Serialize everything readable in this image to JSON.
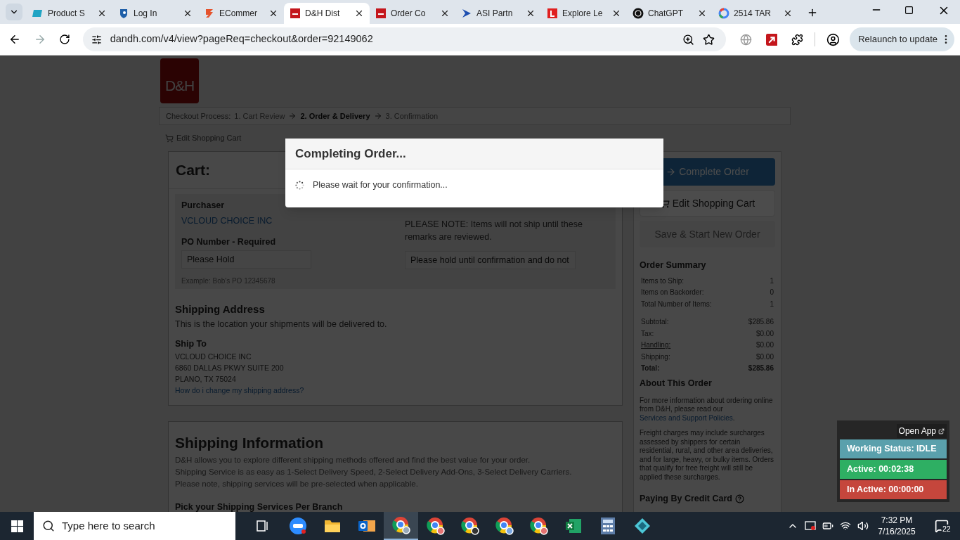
{
  "browser": {
    "tabs": [
      {
        "title": "Product S",
        "selected": false
      },
      {
        "title": "Log In",
        "selected": false
      },
      {
        "title": "ECommer",
        "selected": false
      },
      {
        "title": "D&H Dist",
        "selected": true
      },
      {
        "title": "Order Co",
        "selected": false
      },
      {
        "title": "ASI Partn",
        "selected": false
      },
      {
        "title": "Explore Le",
        "selected": false
      },
      {
        "title": "ChatGPT",
        "selected": false
      },
      {
        "title": "2514 TAR",
        "selected": false
      }
    ],
    "url": "dandh.com/v4/view?pageReq=checkout&order=92149062",
    "relaunch": "Relaunch to update"
  },
  "page": {
    "logo": "D&H",
    "checkout": {
      "label": "Checkout Process:",
      "steps": [
        {
          "label": "1. Cart Review",
          "selected": false
        },
        {
          "label": "2. Order & Delivery",
          "selected": true
        },
        {
          "label": "3. Confirmation",
          "selected": false
        }
      ]
    },
    "edit_cart_link": "Edit Shopping Cart",
    "cart": {
      "title": "Cart:",
      "purchaser_label": "Purchaser",
      "purchaser": "VCLOUD CHOICE INC",
      "po_label": "PO Number - Required",
      "po_value": "Please Hold",
      "po_example": "Example: Bob's PO 12345678",
      "remarks_note": "PLEASE NOTE: Items will not ship until these remarks are reviewed.",
      "remarks_value": "Please hold until confirmation and do not"
    },
    "shipping_address": {
      "title": "Shipping Address",
      "subtitle": "This is the location your shipments will be delivered to.",
      "ship_to_label": "Ship To",
      "lines": [
        "VCLOUD CHOICE INC",
        "6860 DALLAS PKWY SUITE 200",
        "PLANO, TX 75024"
      ],
      "help_link": "How do i change my shipping address?"
    },
    "shipping_info": {
      "title": "Shipping Information",
      "lines": [
        "D&H allows you to explore different shipping methods offered and find the best value for your order.",
        "Shipping Service is as easy as 1-Select Delivery Speed, 2-Select Delivery Add-Ons, 3-Select Delivery Carriers.",
        "Please note, shipping services will be pre-selected when applicable."
      ],
      "subheading": "Pick your Shipping Services Per Branch"
    },
    "sidebar": {
      "complete_button": "Complete Order",
      "edit_button": "Edit Shopping Cart",
      "save_button": "Save & Start New Order",
      "summary_title": "Order Summary",
      "counts": [
        {
          "label": "Items to Ship:",
          "value": "1"
        },
        {
          "label": "Items on Backorder:",
          "value": "0"
        },
        {
          "label": "Total Number of Items:",
          "value": "1"
        }
      ],
      "amounts": [
        {
          "label": "Subtotal:",
          "value": "$285.86",
          "kind": "plain"
        },
        {
          "label": "Tax:",
          "value": "$0.00",
          "kind": "plain"
        },
        {
          "label": "Handling:",
          "value": "$0.00",
          "kind": "link"
        },
        {
          "label": "Shipping:",
          "value": "$0.00",
          "kind": "plain"
        },
        {
          "label": "Total:",
          "value": "$285.86",
          "kind": "total"
        }
      ],
      "about_title": "About This Order",
      "about_text": "For more information about ordering online from D&H, please read our",
      "about_link": "Services and Support Policies",
      "about_end": ".",
      "freight_text": "Freight charges may include surcharges assessed by shippers for certain residential, rural, and other area deliveries, and for large, heavy, or bulky items. Orders that qualify for free freight will still be applied these surcharges.",
      "credit_title": "Paying By Credit Card"
    }
  },
  "modal": {
    "title": "Completing Order...",
    "message": "Please wait for your confirmation..."
  },
  "tracker": {
    "open_app": "Open App",
    "statuses": [
      {
        "label": "Working Status: IDLE",
        "color": "#5aa0ac"
      },
      {
        "label": "Active: 00:02:38",
        "color": "#2eaf63"
      },
      {
        "label": "In Active: 00:00:00",
        "color": "#c5463c"
      }
    ]
  },
  "taskbar": {
    "search_placeholder": "Type here to search",
    "time": "7:32 PM",
    "date": "7/16/2025",
    "notifications": "22"
  }
}
